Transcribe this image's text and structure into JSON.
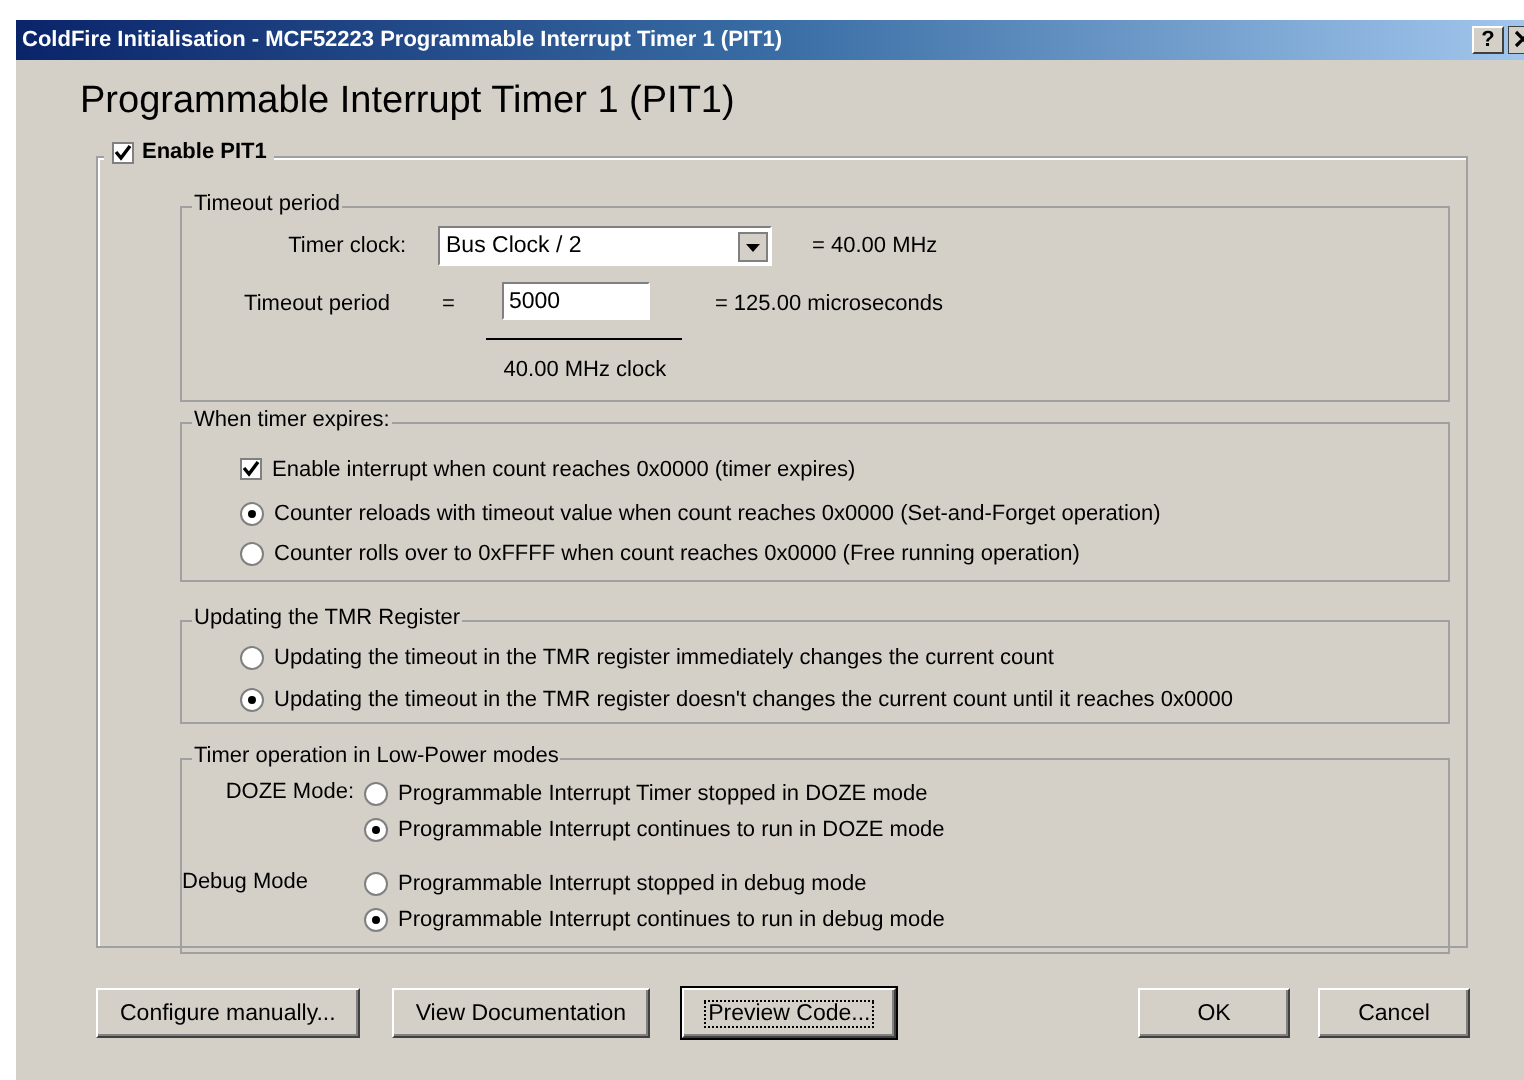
{
  "window": {
    "title": "ColdFire Initialisation - MCF52223 Programmable Interrupt Timer 1 (PIT1)",
    "help_button": "?"
  },
  "heading": "Programmable Interrupt Timer 1 (PIT1)",
  "enable": {
    "label": "Enable PIT1",
    "checked": true
  },
  "timeout_group": {
    "title": "Timeout period",
    "clock_label": "Timer clock:",
    "clock_value": "Bus Clock / 2",
    "clock_freq": "= 40.00 MHz",
    "period_label": "Timeout period",
    "equals": "=",
    "period_value": "5000",
    "result": "= 125.00 microseconds",
    "denominator": "40.00 MHz clock"
  },
  "expire_group": {
    "title": "When timer expires:",
    "interrupt": {
      "label": "Enable interrupt when count reaches 0x0000 (timer expires)",
      "checked": true
    },
    "options": [
      {
        "label": "Counter reloads with timeout value when count reaches 0x0000 (Set-and-Forget operation)",
        "selected": true
      },
      {
        "label": "Counter rolls over to 0xFFFF when count reaches 0x0000 (Free running operation)",
        "selected": false
      }
    ]
  },
  "tmr_group": {
    "title": "Updating the TMR Register",
    "options": [
      {
        "label": "Updating the timeout in the TMR register immediately changes the current count",
        "selected": false
      },
      {
        "label": "Updating the timeout in the TMR register doesn't changes the current count until it reaches 0x0000",
        "selected": true
      }
    ]
  },
  "low_power_group": {
    "title": "Timer operation in Low-Power modes",
    "modes": [
      {
        "label": "DOZE Mode:",
        "options": [
          {
            "label": "Programmable Interrupt Timer stopped in DOZE mode",
            "selected": false
          },
          {
            "label": "Programmable Interrupt continues to run in DOZE mode",
            "selected": true
          }
        ]
      },
      {
        "label": "Debug Mode",
        "options": [
          {
            "label": "Programmable Interrupt stopped in debug mode",
            "selected": false
          },
          {
            "label": "Programmable Interrupt continues to run in debug mode",
            "selected": true
          }
        ]
      }
    ]
  },
  "buttons_left": [
    {
      "label": "Configure manually...",
      "focused": false
    },
    {
      "label": "View Documentation",
      "focused": false
    },
    {
      "label": "Preview Code...",
      "focused": true
    }
  ],
  "buttons_right": [
    {
      "label": "OK",
      "focused": false
    },
    {
      "label": "Cancel",
      "focused": false
    }
  ]
}
